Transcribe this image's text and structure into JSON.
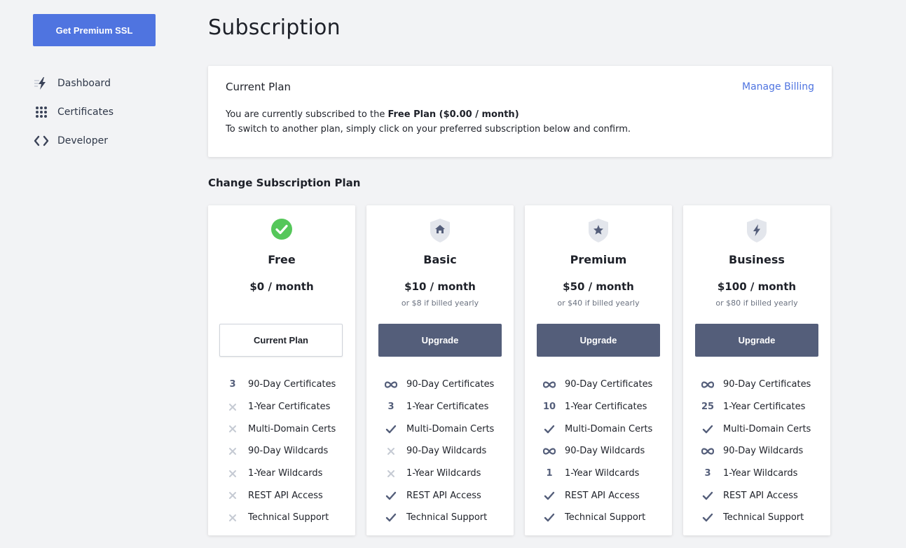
{
  "sidebar": {
    "premium_button": "Get Premium SSL",
    "nav": [
      {
        "label": "Dashboard",
        "icon": "lightning-icon"
      },
      {
        "label": "Certificates",
        "icon": "grid-icon"
      },
      {
        "label": "Developer",
        "icon": "code-icon"
      }
    ]
  },
  "page": {
    "title": "Subscription"
  },
  "current_plan": {
    "title": "Current Plan",
    "manage_billing": "Manage Billing",
    "line1_prefix": "You are currently subscribed to the ",
    "line1_bold": "Free Plan ($0.00 / month)",
    "line2": "To switch to another plan, simply click on your preferred subscription below and confirm."
  },
  "change_plan": {
    "title": "Change Subscription Plan"
  },
  "colors": {
    "accent": "#4f74e0",
    "button": "#545e7a",
    "check_green": "#55c75a"
  },
  "plans": [
    {
      "name": "Free",
      "price": "$0 / month",
      "yearly": "",
      "button": "Current Plan",
      "icon": "check-circle-icon",
      "features": [
        {
          "ind": "3",
          "label": "90-Day Certificates"
        },
        {
          "ind": "x",
          "label": "1-Year Certificates"
        },
        {
          "ind": "x",
          "label": "Multi-Domain Certs"
        },
        {
          "ind": "x",
          "label": "90-Day Wildcards"
        },
        {
          "ind": "x",
          "label": "1-Year Wildcards"
        },
        {
          "ind": "x",
          "label": "REST API Access"
        },
        {
          "ind": "x",
          "label": "Technical Support"
        }
      ]
    },
    {
      "name": "Basic",
      "price": "$10 / month",
      "yearly": "or $8 if billed yearly",
      "button": "Upgrade",
      "icon": "shield-home-icon",
      "features": [
        {
          "ind": "inf",
          "label": "90-Day Certificates"
        },
        {
          "ind": "3",
          "label": "1-Year Certificates"
        },
        {
          "ind": "check",
          "label": "Multi-Domain Certs"
        },
        {
          "ind": "x",
          "label": "90-Day Wildcards"
        },
        {
          "ind": "x",
          "label": "1-Year Wildcards"
        },
        {
          "ind": "check",
          "label": "REST API Access"
        },
        {
          "ind": "check",
          "label": "Technical Support"
        }
      ]
    },
    {
      "name": "Premium",
      "price": "$50 / month",
      "yearly": "or $40 if billed yearly",
      "button": "Upgrade",
      "icon": "shield-star-icon",
      "features": [
        {
          "ind": "inf",
          "label": "90-Day Certificates"
        },
        {
          "ind": "10",
          "label": "1-Year Certificates"
        },
        {
          "ind": "check",
          "label": "Multi-Domain Certs"
        },
        {
          "ind": "inf",
          "label": "90-Day Wildcards"
        },
        {
          "ind": "1",
          "label": "1-Year Wildcards"
        },
        {
          "ind": "check",
          "label": "REST API Access"
        },
        {
          "ind": "check",
          "label": "Technical Support"
        }
      ]
    },
    {
      "name": "Business",
      "price": "$100 / month",
      "yearly": "or $80 if billed yearly",
      "button": "Upgrade",
      "icon": "shield-bolt-icon",
      "features": [
        {
          "ind": "inf",
          "label": "90-Day Certificates"
        },
        {
          "ind": "25",
          "label": "1-Year Certificates"
        },
        {
          "ind": "check",
          "label": "Multi-Domain Certs"
        },
        {
          "ind": "inf",
          "label": "90-Day Wildcards"
        },
        {
          "ind": "3",
          "label": "1-Year Wildcards"
        },
        {
          "ind": "check",
          "label": "REST API Access"
        },
        {
          "ind": "check",
          "label": "Technical Support"
        }
      ]
    }
  ]
}
